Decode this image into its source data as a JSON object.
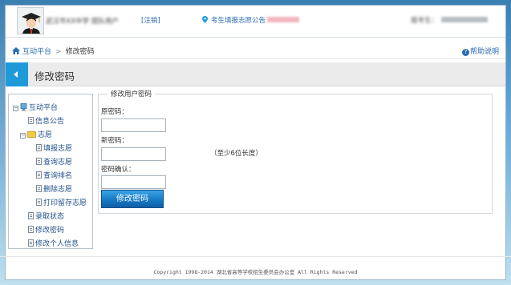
{
  "header": {
    "school_name": "武汉市XX中学 团队用户",
    "logout_label": "[注销]",
    "notice_label": "考生填报志愿公告",
    "candidate_label": "报考生："
  },
  "breadcrumb": {
    "home_label": "互动平台",
    "separator": ">",
    "current_label": "修改密码"
  },
  "help_label": "帮助说明",
  "page_title": "修改密码",
  "sidebar": {
    "root_label": "互动平台",
    "items": [
      {
        "label": "信息公告"
      },
      {
        "label": "志愿"
      },
      {
        "label": "填报志愿"
      },
      {
        "label": "查询志愿"
      },
      {
        "label": "查询排名"
      },
      {
        "label": "删除志愿"
      },
      {
        "label": "打印留存志愿"
      },
      {
        "label": "录取状态"
      },
      {
        "label": "修改密码"
      },
      {
        "label": "修改个人信息"
      }
    ],
    "toggle_minus": "−"
  },
  "form": {
    "legend": "修改用户密码",
    "old_password_label": "原密码：",
    "new_password_label": "新密码：",
    "confirm_password_label": "密码确认：",
    "hint": "（至少6位长度）",
    "submit_label": "修改密码",
    "old_password_value": "",
    "new_password_value": "",
    "confirm_password_value": ""
  },
  "footer": "Copyright 1998-2014 湖北省高等学校招生委员会办公室 All Rights Reserved",
  "colors": {
    "accent": "#1f9ad9",
    "link": "#2a6cb0",
    "button": "#1679c4"
  }
}
